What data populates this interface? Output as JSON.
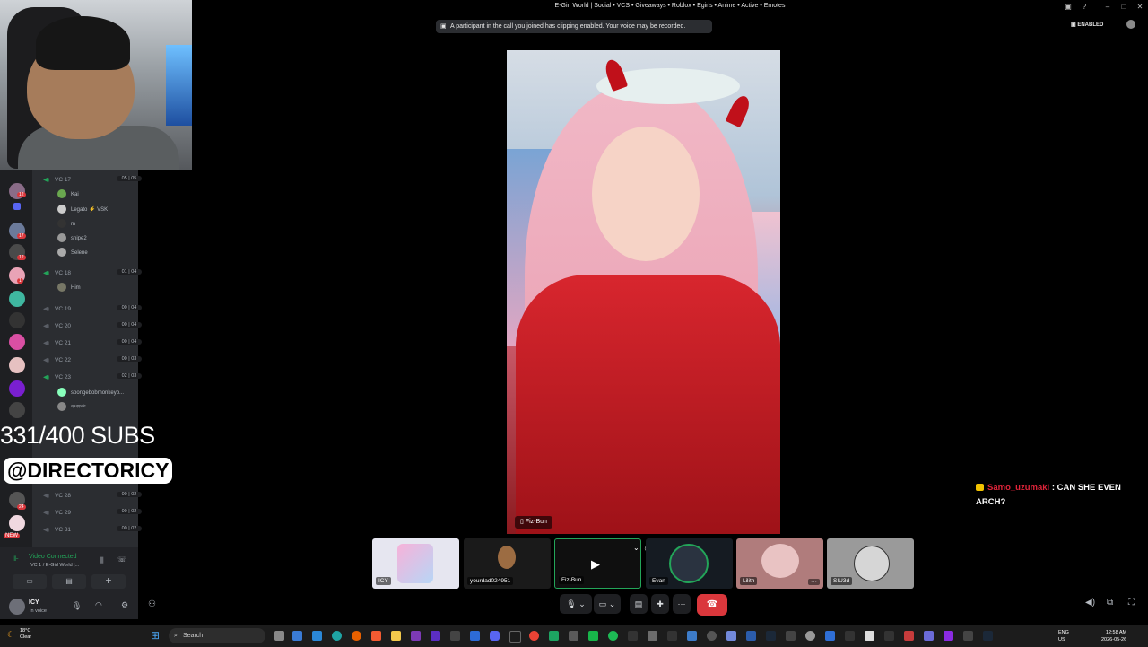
{
  "window": {
    "title": "E-Girl World | Social • VCS • Giveaways • Roblox • Egirls • Anime • Active • Emotes",
    "clipping_notice": "A participant in the call you joined has clipping enabled. Your voice may be recorded.",
    "clipping_status": "ENABLED"
  },
  "server_rail": {
    "badges": [
      "12",
      "17",
      "12",
      "1",
      "24",
      "NEW"
    ]
  },
  "channels": [
    {
      "name": "VC 17",
      "count": "05 | 05",
      "active": true,
      "members": [
        "Kai",
        "Legato ⚡ VSK",
        "m",
        "snipe2",
        "Selene"
      ]
    },
    {
      "name": "VC 18",
      "count": "01 | 04",
      "active": true,
      "members": [
        "Him"
      ]
    },
    {
      "name": "VC 19",
      "count": "00 | 04",
      "active": false,
      "members": []
    },
    {
      "name": "VC 20",
      "count": "00 | 04",
      "active": false,
      "members": []
    },
    {
      "name": "VC 21",
      "count": "00 | 04",
      "active": false,
      "members": []
    },
    {
      "name": "VC 22",
      "count": "00 | 03",
      "active": false,
      "members": []
    },
    {
      "name": "VC 23",
      "count": "02 | 03",
      "active": true,
      "members": [
        "spongebobmonkeyb...",
        "ᵒᵖᵘᵖᵖᵃⁱᶜ"
      ]
    },
    {
      "name": "VC 28",
      "count": "00 | 02",
      "active": false,
      "members": []
    },
    {
      "name": "VC 29",
      "count": "00 | 02",
      "active": false,
      "members": []
    },
    {
      "name": "VC 31",
      "count": "00 | 02",
      "active": false,
      "members": []
    }
  ],
  "overlay": {
    "subs": "331/400 SUBS",
    "handle": "@DIRECTORICY"
  },
  "voice_panel": {
    "status": "Video Connected",
    "location": "VC 1 / E-Girl World |..."
  },
  "user": {
    "name": "ICY",
    "status": "In voice"
  },
  "main_video": {
    "name": "Fiz-Bun"
  },
  "chat": {
    "user": "Samo_uzumaki",
    "message": ": CAN SHE EVEN ARCH?"
  },
  "tiles": [
    {
      "name": "ICY",
      "color": "#e6e6f0"
    },
    {
      "name": "yourdad024951",
      "color": "#1a1a1a"
    },
    {
      "name": "Fiz-Bun",
      "color": "#0f0f0f"
    },
    {
      "name": "Evan",
      "color": "#151b22"
    },
    {
      "name": "Lilith",
      "color": "#b07c7c"
    },
    {
      "name": "SIU3d",
      "color": "#9a9a9a"
    }
  ],
  "taskbar": {
    "temp": "18°C",
    "weather": "Clear",
    "search": "Search",
    "lang1": "ENG",
    "lang2": "US",
    "time": "12:58 AM",
    "date": "2026-05-26"
  },
  "colors": {
    "accent_green": "#23a559",
    "hangup_red": "#da373c",
    "chat_red": "#e0243a"
  }
}
